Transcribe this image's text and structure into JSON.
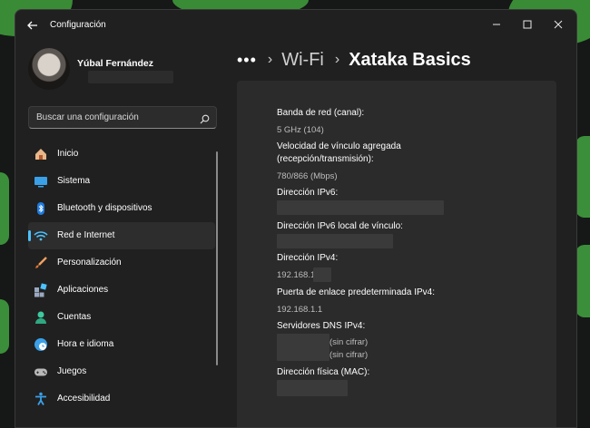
{
  "window": {
    "title": "Configuración"
  },
  "user": {
    "name": "Yúbal Fernández"
  },
  "search": {
    "placeholder": "Buscar una configuración"
  },
  "sidebar": {
    "items": [
      {
        "label": "Inicio",
        "icon": "home-icon"
      },
      {
        "label": "Sistema",
        "icon": "system-icon"
      },
      {
        "label": "Bluetooth y dispositivos",
        "icon": "bluetooth-icon"
      },
      {
        "label": "Red e Internet",
        "icon": "network-icon",
        "selected": true
      },
      {
        "label": "Personalización",
        "icon": "brush-icon"
      },
      {
        "label": "Aplicaciones",
        "icon": "apps-icon"
      },
      {
        "label": "Cuentas",
        "icon": "accounts-icon"
      },
      {
        "label": "Hora e idioma",
        "icon": "time-language-icon"
      },
      {
        "label": "Juegos",
        "icon": "gamepad-icon"
      },
      {
        "label": "Accesibilidad",
        "icon": "accessibility-icon"
      }
    ]
  },
  "breadcrumb": {
    "more": "•••",
    "sep": "›",
    "parent": "Wi-Fi",
    "current": "Xataka Basics"
  },
  "details": {
    "band_label": "Banda de red (canal):",
    "band_value": "5 GHz (104)",
    "speed_label_1": "Velocidad de vínculo agregada",
    "speed_label_2": "(recepción/transmisión):",
    "speed_value": "780/866 (Mbps)",
    "ipv6_label": "Dirección IPv6:",
    "ipv6_link_label": "Dirección IPv6 local de vínculo:",
    "ipv4_label": "Dirección IPv4:",
    "ipv4_value": "192.168.1",
    "gateway_label": "Puerta de enlace predeterminada IPv4:",
    "gateway_value": "192.168.1.1",
    "dns_label": "Servidores DNS IPv4:",
    "dns_note_1": "(sin cifrar)",
    "dns_note_2": "(sin cifrar)",
    "mac_label": "Dirección física (MAC):"
  },
  "colors": {
    "accent": "#4cc2ff",
    "window_bg": "#202020",
    "panel_bg": "#2b2b2b"
  }
}
